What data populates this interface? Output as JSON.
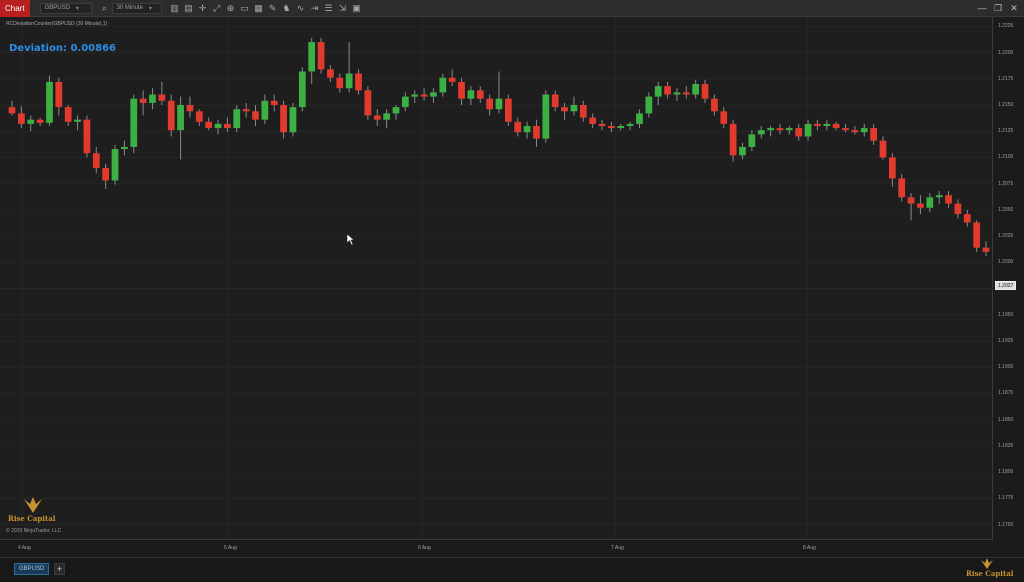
{
  "toolbar": {
    "chart_tab_label": "Chart",
    "instrument": "GBPUSD",
    "interval": "30 Minute",
    "tools": [
      "bar-chart-icon",
      "data-box-icon",
      "crosshair-icon",
      "zoom-icon",
      "magnify-icon",
      "properties-icon",
      "templates-icon",
      "drawing-tools-icon",
      "strategies-icon",
      "indicators-icon",
      "shift-icon",
      "list-icon",
      "expand-icon",
      "tiles-icon"
    ]
  },
  "chart": {
    "label": "RCDeviationCounter(GBPUSD (30 Minute),1)",
    "deviation_text": "Deviation: 0.00866",
    "copyright": "© 2019 NinjaTrader, LLC",
    "logo_text": "Rise Capital",
    "last_price": "1.2027",
    "up_color": "#3cb043",
    "down_color": "#e23a2c"
  },
  "chart_data": {
    "type": "candlestick",
    "y_ticks": [
      "1.2225",
      "1.2200",
      "1.2175",
      "1.2150",
      "1.2125",
      "1.2100",
      "1.2075",
      "1.2050",
      "1.2025",
      "1.2000",
      "1.1975",
      "1.1950",
      "1.1925",
      "1.1900",
      "1.1875",
      "1.1850",
      "1.1825",
      "1.1800",
      "1.1775",
      "1.1750"
    ],
    "x_ticks": [
      "4 Aug",
      "5 Aug",
      "6 Aug",
      "7 Aug",
      "8 Aug"
    ],
    "ylim": [
      1.174,
      1.2232
    ],
    "ohlc": [
      [
        1.2148,
        1.2154,
        1.214,
        1.2142
      ],
      [
        1.2142,
        1.2149,
        1.2128,
        1.2132
      ],
      [
        1.2132,
        1.214,
        1.2125,
        1.2136
      ],
      [
        1.2136,
        1.2138,
        1.213,
        1.2133
      ],
      [
        1.2133,
        1.2178,
        1.213,
        1.2172
      ],
      [
        1.2172,
        1.2176,
        1.214,
        1.2148
      ],
      [
        1.2148,
        1.215,
        1.213,
        1.2134
      ],
      [
        1.2134,
        1.214,
        1.2126,
        1.2136
      ],
      [
        1.2136,
        1.214,
        1.21,
        1.2104
      ],
      [
        1.2104,
        1.211,
        1.2085,
        1.209
      ],
      [
        1.209,
        1.2094,
        1.207,
        1.2078
      ],
      [
        1.2078,
        1.2112,
        1.2074,
        1.2108
      ],
      [
        1.2108,
        1.2116,
        1.2102,
        1.211
      ],
      [
        1.211,
        1.216,
        1.2104,
        1.2156
      ],
      [
        1.2156,
        1.2164,
        1.214,
        1.2152
      ],
      [
        1.2152,
        1.2166,
        1.2146,
        1.216
      ],
      [
        1.216,
        1.2172,
        1.215,
        1.2154
      ],
      [
        1.2154,
        1.216,
        1.212,
        1.2126
      ],
      [
        1.2126,
        1.2158,
        1.2098,
        1.215
      ],
      [
        1.215,
        1.2158,
        1.2138,
        1.2144
      ],
      [
        1.2144,
        1.2146,
        1.213,
        1.2134
      ],
      [
        1.2134,
        1.2138,
        1.2126,
        1.2128
      ],
      [
        1.2128,
        1.2136,
        1.2122,
        1.2132
      ],
      [
        1.2132,
        1.2138,
        1.2124,
        1.2128
      ],
      [
        1.2128,
        1.215,
        1.2124,
        1.2146
      ],
      [
        1.2146,
        1.2152,
        1.2138,
        1.2144
      ],
      [
        1.2144,
        1.215,
        1.213,
        1.2136
      ],
      [
        1.2136,
        1.216,
        1.2132,
        1.2154
      ],
      [
        1.2154,
        1.216,
        1.2144,
        1.215
      ],
      [
        1.215,
        1.2154,
        1.2118,
        1.2124
      ],
      [
        1.2124,
        1.2152,
        1.212,
        1.2148
      ],
      [
        1.2148,
        1.2186,
        1.2144,
        1.2182
      ],
      [
        1.2182,
        1.2214,
        1.217,
        1.221
      ],
      [
        1.221,
        1.2214,
        1.218,
        1.2184
      ],
      [
        1.2184,
        1.2188,
        1.2172,
        1.2176
      ],
      [
        1.2176,
        1.218,
        1.2162,
        1.2166
      ],
      [
        1.2166,
        1.221,
        1.2162,
        1.218
      ],
      [
        1.218,
        1.2184,
        1.216,
        1.2164
      ],
      [
        1.2164,
        1.2168,
        1.2136,
        1.214
      ],
      [
        1.214,
        1.2146,
        1.213,
        1.2136
      ],
      [
        1.2136,
        1.2146,
        1.2128,
        1.2142
      ],
      [
        1.2142,
        1.215,
        1.2136,
        1.2148
      ],
      [
        1.2148,
        1.2162,
        1.2144,
        1.2158
      ],
      [
        1.2158,
        1.2164,
        1.2152,
        1.216
      ],
      [
        1.216,
        1.2166,
        1.2154,
        1.2158
      ],
      [
        1.2158,
        1.2166,
        1.2152,
        1.2162
      ],
      [
        1.2162,
        1.218,
        1.2158,
        1.2176
      ],
      [
        1.2176,
        1.2184,
        1.2168,
        1.2172
      ],
      [
        1.2172,
        1.2176,
        1.215,
        1.2156
      ],
      [
        1.2156,
        1.2168,
        1.215,
        1.2164
      ],
      [
        1.2164,
        1.2168,
        1.2152,
        1.2156
      ],
      [
        1.2156,
        1.216,
        1.214,
        1.2146
      ],
      [
        1.2146,
        1.2182,
        1.2142,
        1.2156
      ],
      [
        1.2156,
        1.216,
        1.213,
        1.2134
      ],
      [
        1.2134,
        1.2138,
        1.212,
        1.2124
      ],
      [
        1.2124,
        1.2134,
        1.2118,
        1.213
      ],
      [
        1.213,
        1.2136,
        1.211,
        1.2118
      ],
      [
        1.2118,
        1.2164,
        1.2114,
        1.216
      ],
      [
        1.216,
        1.2164,
        1.2144,
        1.2148
      ],
      [
        1.2148,
        1.2152,
        1.2136,
        1.2144
      ],
      [
        1.2144,
        1.2158,
        1.214,
        1.215
      ],
      [
        1.215,
        1.2154,
        1.2134,
        1.2138
      ],
      [
        1.2138,
        1.2142,
        1.2128,
        1.2132
      ],
      [
        1.2132,
        1.2136,
        1.2126,
        1.213
      ],
      [
        1.213,
        1.2134,
        1.2124,
        1.2128
      ],
      [
        1.2128,
        1.2132,
        1.2126,
        1.213
      ],
      [
        1.213,
        1.2134,
        1.2126,
        1.2132
      ],
      [
        1.2132,
        1.2146,
        1.2128,
        1.2142
      ],
      [
        1.2142,
        1.2162,
        1.2138,
        1.2158
      ],
      [
        1.2158,
        1.2172,
        1.215,
        1.2168
      ],
      [
        1.2168,
        1.2172,
        1.2156,
        1.216
      ],
      [
        1.216,
        1.2166,
        1.2154,
        1.2162
      ],
      [
        1.2162,
        1.2168,
        1.2156,
        1.216
      ],
      [
        1.216,
        1.2174,
        1.2156,
        1.217
      ],
      [
        1.217,
        1.2174,
        1.2152,
        1.2156
      ],
      [
        1.2156,
        1.216,
        1.214,
        1.2144
      ],
      [
        1.2144,
        1.2148,
        1.2128,
        1.2132
      ],
      [
        1.2132,
        1.2136,
        1.2096,
        1.2102
      ],
      [
        1.2102,
        1.2114,
        1.2098,
        1.211
      ],
      [
        1.211,
        1.2126,
        1.2106,
        1.2122
      ],
      [
        1.2122,
        1.213,
        1.2118,
        1.2126
      ],
      [
        1.2126,
        1.213,
        1.212,
        1.2128
      ],
      [
        1.2128,
        1.2132,
        1.2122,
        1.2126
      ],
      [
        1.2126,
        1.213,
        1.2122,
        1.2128
      ],
      [
        1.2128,
        1.2132,
        1.2116,
        1.212
      ],
      [
        1.212,
        1.2136,
        1.2116,
        1.2132
      ],
      [
        1.2132,
        1.2136,
        1.2126,
        1.213
      ],
      [
        1.213,
        1.2136,
        1.2126,
        1.2132
      ],
      [
        1.2132,
        1.2134,
        1.2126,
        1.2128
      ],
      [
        1.2128,
        1.2132,
        1.2124,
        1.2126
      ],
      [
        1.2126,
        1.213,
        1.2122,
        1.2124
      ],
      [
        1.2124,
        1.2132,
        1.212,
        1.2128
      ],
      [
        1.2128,
        1.2132,
        1.2112,
        1.2116
      ],
      [
        1.2116,
        1.212,
        1.2098,
        1.21
      ],
      [
        1.21,
        1.2104,
        1.2072,
        1.208
      ],
      [
        1.208,
        1.2084,
        1.2058,
        1.2062
      ],
      [
        1.2062,
        1.2066,
        1.204,
        1.2056
      ],
      [
        1.2056,
        1.2064,
        1.2046,
        1.2052
      ],
      [
        1.2052,
        1.2066,
        1.2048,
        1.2062
      ],
      [
        1.2062,
        1.2068,
        1.2056,
        1.2064
      ],
      [
        1.2064,
        1.2068,
        1.2052,
        1.2056
      ],
      [
        1.2056,
        1.206,
        1.2042,
        1.2046
      ],
      [
        1.2046,
        1.205,
        1.2034,
        1.2038
      ],
      [
        1.2038,
        1.204,
        1.201,
        1.2014
      ],
      [
        1.2014,
        1.202,
        1.2006,
        1.201
      ]
    ]
  }
}
